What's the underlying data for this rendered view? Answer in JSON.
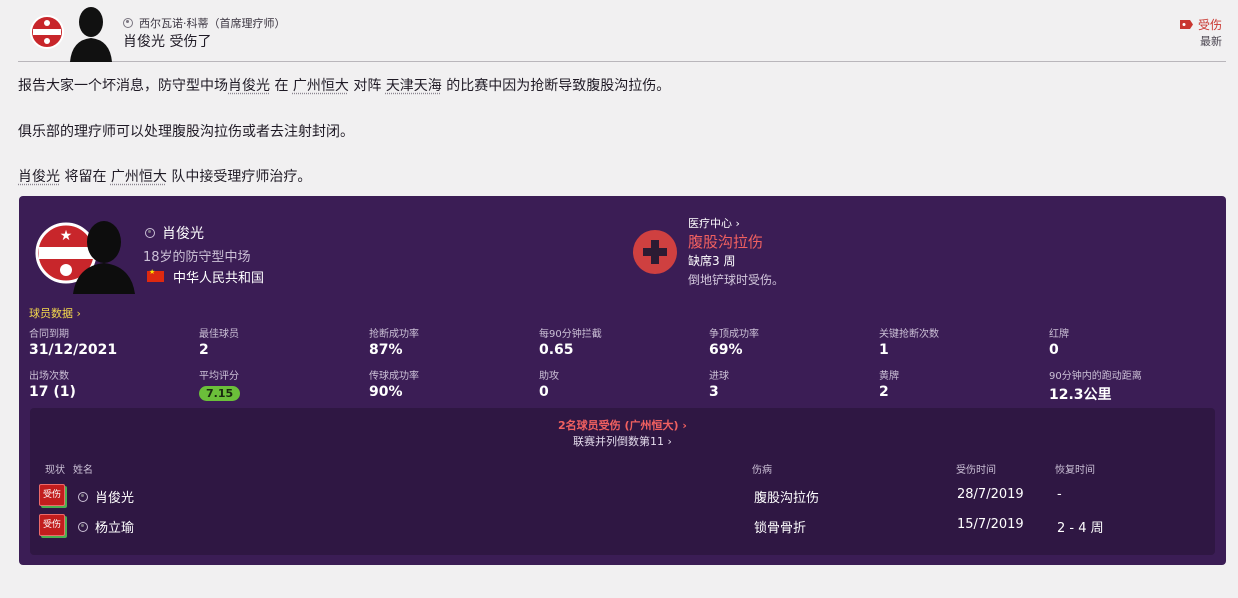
{
  "header": {
    "sender": "西尔瓦诺·科蒂（首席理疗师）",
    "title": "肖俊光 受伤了",
    "tag": "受伤",
    "latest": "最新"
  },
  "body": {
    "p1": {
      "pre": "报告大家一个坏消息，防守型中场",
      "player": "肖俊光",
      "mid1": "在",
      "club": "广州恒大",
      "mid2": "对阵",
      "opp": "天津天海",
      "post": "的比赛中因为抢断导致腹股沟拉伤。"
    },
    "p2": "俱乐部的理疗师可以处理腹股沟拉伤或者去注射封闭。",
    "p3": {
      "player": "肖俊光",
      "mid": "将留在",
      "club": "广州恒大",
      "post": "队中接受理疗师治疗。"
    }
  },
  "player": {
    "name": "肖俊光",
    "age_position": "18岁的防守型中场",
    "nation": "中华人民共和国"
  },
  "medical": {
    "link": "医疗中心",
    "injury": "腹股沟拉伤",
    "out": "缺席3 周",
    "desc": "倒地铲球时受伤。"
  },
  "stats_link": "球员数据",
  "stats": [
    {
      "label": "合同到期",
      "value": "31/12/2021"
    },
    {
      "label": "最佳球员",
      "value": "2"
    },
    {
      "label": "抢断成功率",
      "value": "87%"
    },
    {
      "label": "每90分钟拦截",
      "value": "0.65"
    },
    {
      "label": "争顶成功率",
      "value": "69%"
    },
    {
      "label": "关键抢断次数",
      "value": "1"
    },
    {
      "label": "红牌",
      "value": "0"
    },
    {
      "label": "出场次数",
      "value": "17 (1)"
    },
    {
      "label": "平均评分",
      "value": "7.15"
    },
    {
      "label": "传球成功率",
      "value": "90%"
    },
    {
      "label": "助攻",
      "value": "0"
    },
    {
      "label": "进球",
      "value": "3"
    },
    {
      "label": "黄牌",
      "value": "2"
    },
    {
      "label": "90分钟内的跑动距离",
      "value": "12.3公里"
    }
  ],
  "injuries": {
    "heading": "2名球员受伤 (广州恒大)",
    "league": "联赛并列倒数第11",
    "columns": {
      "status": "现状",
      "name": "姓名",
      "injury": "伤病",
      "date": "受伤时间",
      "recovery": "恢复时间"
    },
    "rows": [
      {
        "status": "受伤",
        "name": "肖俊光",
        "injury": "腹股沟拉伤",
        "date": "28/7/2019",
        "recovery": "-"
      },
      {
        "status": "受伤",
        "name": "杨立瑜",
        "injury": "锁骨骨折",
        "date": "15/7/2019",
        "recovery": "2 - 4 周"
      }
    ]
  }
}
